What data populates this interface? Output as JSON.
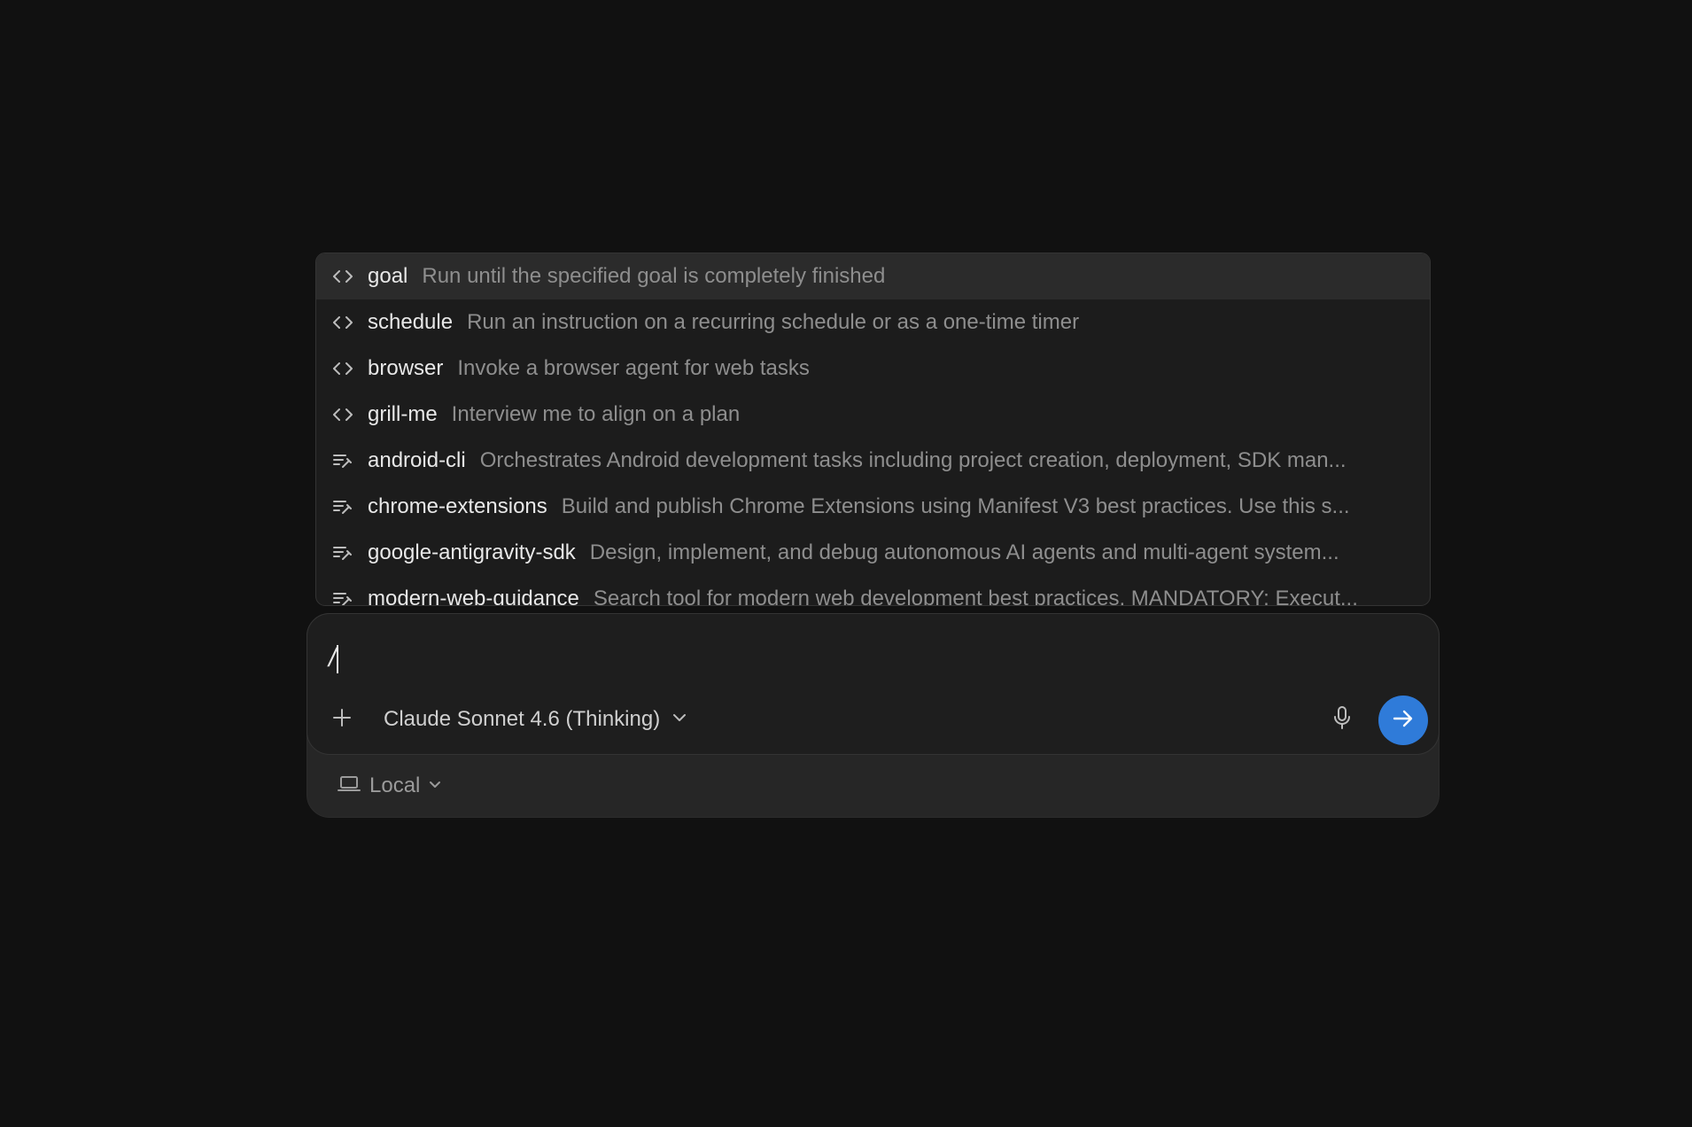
{
  "commands": [
    {
      "name": "goal",
      "description": "Run until the specified goal is completely finished",
      "icon": "code-brackets-icon",
      "selected": true
    },
    {
      "name": "schedule",
      "description": "Run an instruction on a recurring schedule or as a one-time timer",
      "icon": "code-brackets-icon"
    },
    {
      "name": "browser",
      "description": "Invoke a browser agent for web tasks",
      "icon": "code-brackets-icon"
    },
    {
      "name": "grill-me",
      "description": "Interview me to align on a plan",
      "icon": "code-brackets-icon"
    },
    {
      "name": "android-cli",
      "description": "Orchestrates Android development tasks including project creation, deployment, SDK man...",
      "icon": "skill-lines-icon"
    },
    {
      "name": "chrome-extensions",
      "description": "Build and publish Chrome Extensions using Manifest V3 best practices. Use this s...",
      "icon": "skill-lines-icon"
    },
    {
      "name": "google-antigravity-sdk",
      "description": "Design, implement, and debug autonomous AI agents and multi-agent system...",
      "icon": "skill-lines-icon"
    },
    {
      "name": "modern-web-guidance",
      "description": "Search tool for modern web development best practices. MANDATORY: Execut...",
      "icon": "skill-lines-icon"
    }
  ],
  "composer": {
    "input_value": "/",
    "model_label": "Claude Sonnet 4.6 (Thinking)",
    "environment_label": "Local"
  },
  "colors": {
    "background": "#111111",
    "send_button": "#2f7bd9"
  }
}
